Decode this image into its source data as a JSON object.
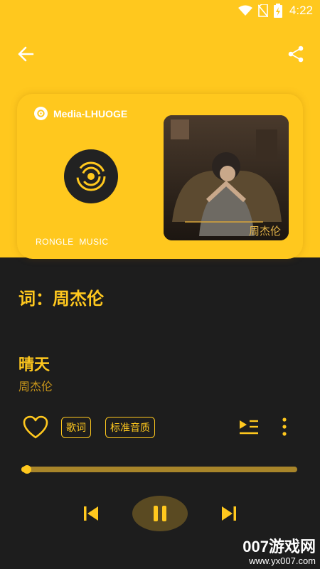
{
  "status_bar": {
    "time": "4:22",
    "icons": [
      "wifi-icon",
      "no-sim-icon",
      "battery-charging-icon"
    ]
  },
  "app_bar": {
    "back_icon": "arrow-left-icon",
    "share_icon": "share-icon"
  },
  "card": {
    "brand_name": "Media-LHUOGE",
    "footer_text": "RONGLE  MUSIC",
    "cover_art_text": "周杰伦"
  },
  "lyric_line": "词：周杰伦",
  "song": {
    "title": "晴天",
    "artist": "周杰伦"
  },
  "actions": {
    "lyrics_button": "歌词",
    "quality_button": "标准音质"
  },
  "progress": {
    "fraction": 0.02
  },
  "controls": {
    "state": "playing"
  },
  "watermark": {
    "main": "007游戏网",
    "sub": "www.yx007.com"
  },
  "colors": {
    "accent": "#ffc81e",
    "background": "#1d1d1d",
    "progress_track": "#a8852a"
  }
}
